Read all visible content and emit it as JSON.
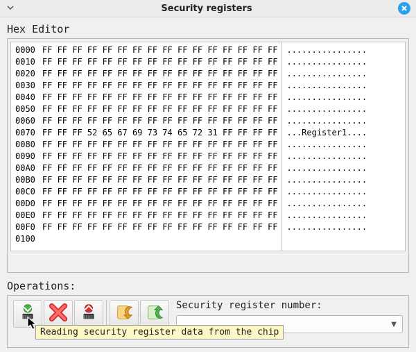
{
  "window": {
    "title": "Security registers"
  },
  "hex": {
    "label": "Hex Editor",
    "offsets": "0000\n0010\n0020\n0030\n0040\n0050\n0060\n0070\n0080\n0090\n00A0\n00B0\n00C0\n00D0\n00E0\n00F0\n0100",
    "bytes": "FF FF FF FF FF FF FF FF FF FF FF FF FF FF FF FF\nFF FF FF FF FF FF FF FF FF FF FF FF FF FF FF FF\nFF FF FF FF FF FF FF FF FF FF FF FF FF FF FF FF\nFF FF FF FF FF FF FF FF FF FF FF FF FF FF FF FF\nFF FF FF FF FF FF FF FF FF FF FF FF FF FF FF FF\nFF FF FF FF FF FF FF FF FF FF FF FF FF FF FF FF\nFF FF FF FF FF FF FF FF FF FF FF FF FF FF FF FF\nFF FF FF 52 65 67 69 73 74 65 72 31 FF FF FF FF\nFF FF FF FF FF FF FF FF FF FF FF FF FF FF FF FF\nFF FF FF FF FF FF FF FF FF FF FF FF FF FF FF FF\nFF FF FF FF FF FF FF FF FF FF FF FF FF FF FF FF\nFF FF FF FF FF FF FF FF FF FF FF FF FF FF FF FF\nFF FF FF FF FF FF FF FF FF FF FF FF FF FF FF FF\nFF FF FF FF FF FF FF FF FF FF FF FF FF FF FF FF\nFF FF FF FF FF FF FF FF FF FF FF FF FF FF FF FF\nFF FF FF FF FF FF FF FF FF FF FF FF FF FF FF FF\n",
    "ascii": "................\n................\n................\n................\n................\n................\n................\n...Register1....\n................\n................\n................\n................\n................\n................\n................\n................\n"
  },
  "ops": {
    "label": "Operations:",
    "reg_label": "Security register number:",
    "reg_value": "",
    "tooltip": "Reading security register data from the chip",
    "buttons": {
      "read": {
        "icon": "read-chip-icon"
      },
      "erase": {
        "icon": "erase-x-icon"
      },
      "write": {
        "icon": "write-chip-icon"
      },
      "import": {
        "icon": "import-icon"
      },
      "export": {
        "icon": "export-icon"
      }
    }
  }
}
